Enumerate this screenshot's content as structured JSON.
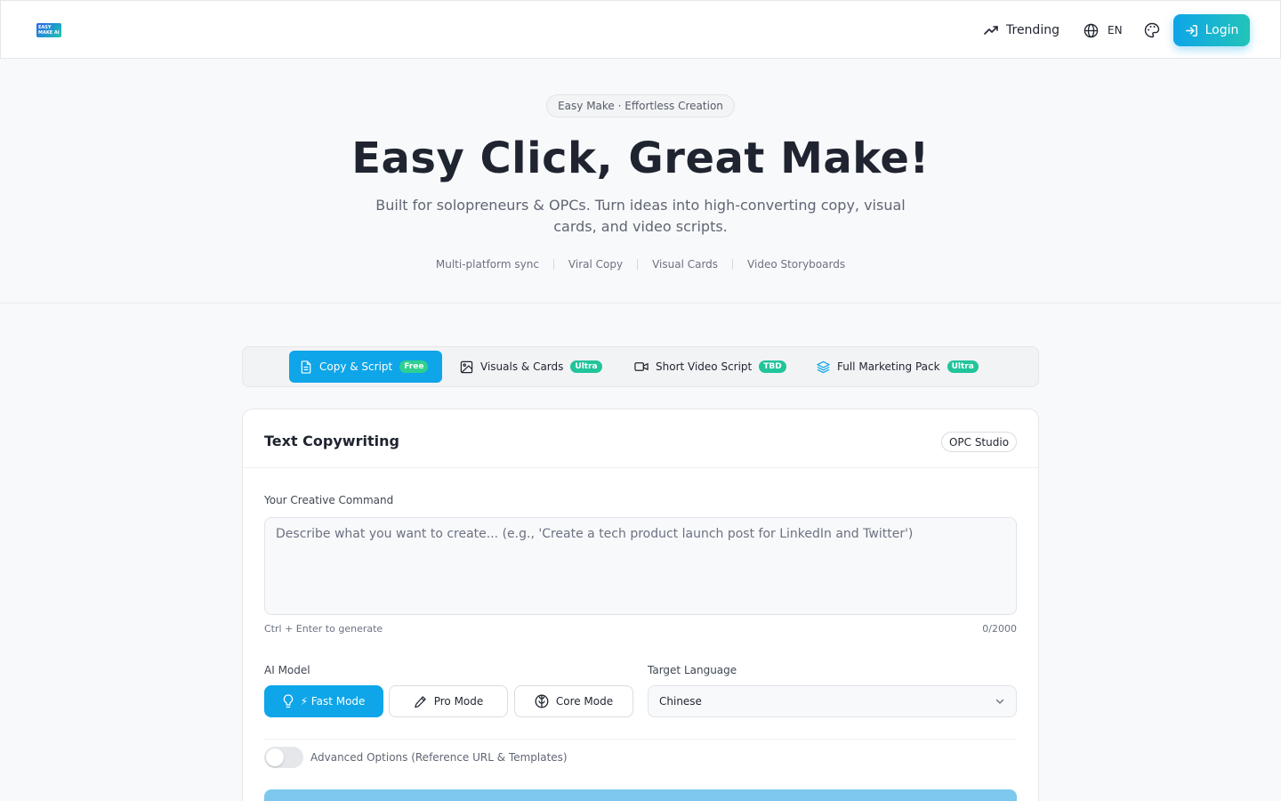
{
  "header": {
    "logo_line1": "EASY",
    "logo_line2": "MAKE AI",
    "trending_label": "Trending",
    "lang_label": "EN",
    "login_label": "Login"
  },
  "hero": {
    "pill": "Easy Make · Effortless Creation",
    "title": "Easy Click, Great Make!",
    "subtitle": "Built for solopreneurs & OPCs. Turn ideas into high-converting copy, visual cards, and video scripts.",
    "features": [
      "Multi-platform sync",
      "Viral Copy",
      "Visual Cards",
      "Video Storyboards"
    ]
  },
  "tabs": [
    {
      "label": "Copy & Script",
      "badge": "Free",
      "icon": "document-icon",
      "active": true
    },
    {
      "label": "Visuals & Cards",
      "badge": "Ultra",
      "icon": "image-icon",
      "active": false
    },
    {
      "label": "Short Video Script",
      "badge": "TBD",
      "icon": "video-icon",
      "active": false
    },
    {
      "label": "Full Marketing Pack",
      "badge": "Ultra",
      "icon": "layers-icon",
      "active": false
    }
  ],
  "card": {
    "title": "Text Copywriting",
    "studio_badge": "OPC Studio",
    "command_label": "Your Creative Command",
    "command_placeholder": "Describe what you want to create... (e.g., 'Create a tech product launch post for LinkedIn and Twitter')",
    "command_value": "",
    "hint": "Ctrl + Enter to generate",
    "counter": "0/2000",
    "model_label": "AI Model",
    "modes": [
      {
        "label": "⚡ Fast Mode",
        "icon": "lightbulb-icon",
        "active": true
      },
      {
        "label": " Pro Mode",
        "icon": "pencil-icon",
        "active": false
      },
      {
        "label": " Core Mode",
        "icon": "brain-icon",
        "active": false
      }
    ],
    "language_label": "Target Language",
    "language_value": "Chinese",
    "advanced_label": "Advanced Options (Reference URL & Templates)"
  },
  "colors": {
    "accent": "#0ea5e9",
    "accent_gradient_end": "#22c4b8",
    "badge_green": "#22c49a"
  }
}
